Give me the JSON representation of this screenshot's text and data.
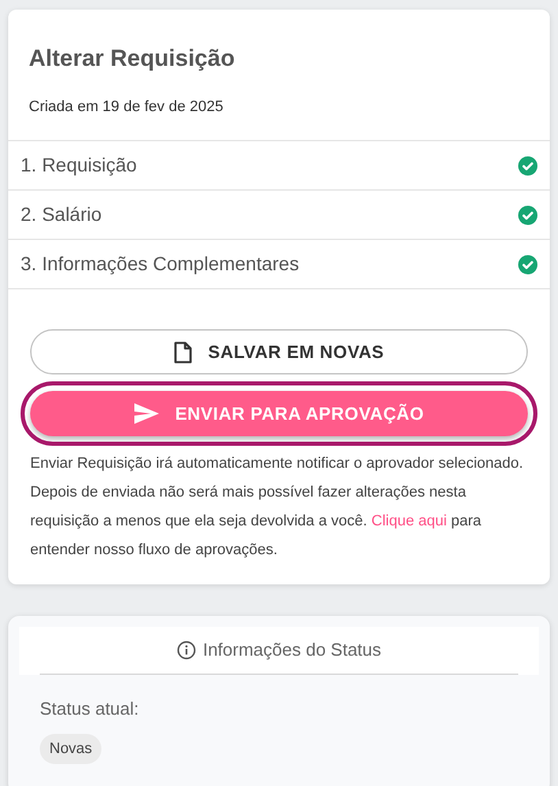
{
  "card": {
    "title": "Alterar Requisição",
    "subtitle": "Criada em 19 de fev de 2025"
  },
  "steps": [
    {
      "label": "1. Requisição",
      "done": true
    },
    {
      "label": "2. Salário",
      "done": true
    },
    {
      "label": "3. Informações Complementares",
      "done": true
    }
  ],
  "buttons": [
    {
      "kind": "outline",
      "label": "SALVAR EM NOVAS",
      "highlighted": false
    },
    {
      "kind": "primary",
      "label": "ENVIAR PARA APROVAÇÃO",
      "highlighted": true
    }
  ],
  "notice": {
    "before": "Enviar Requisição irá automaticamente notificar o aprovador selecionado. Depois de enviada não será mais possível fazer alterações nesta requisição a menos que ela seja devolvida a você. ",
    "link": "Clique aqui",
    "after": " para entender nosso fluxo de aprovações."
  },
  "status": {
    "header": "Informações do Status",
    "label": "Status atual:",
    "badge": "Novas"
  }
}
